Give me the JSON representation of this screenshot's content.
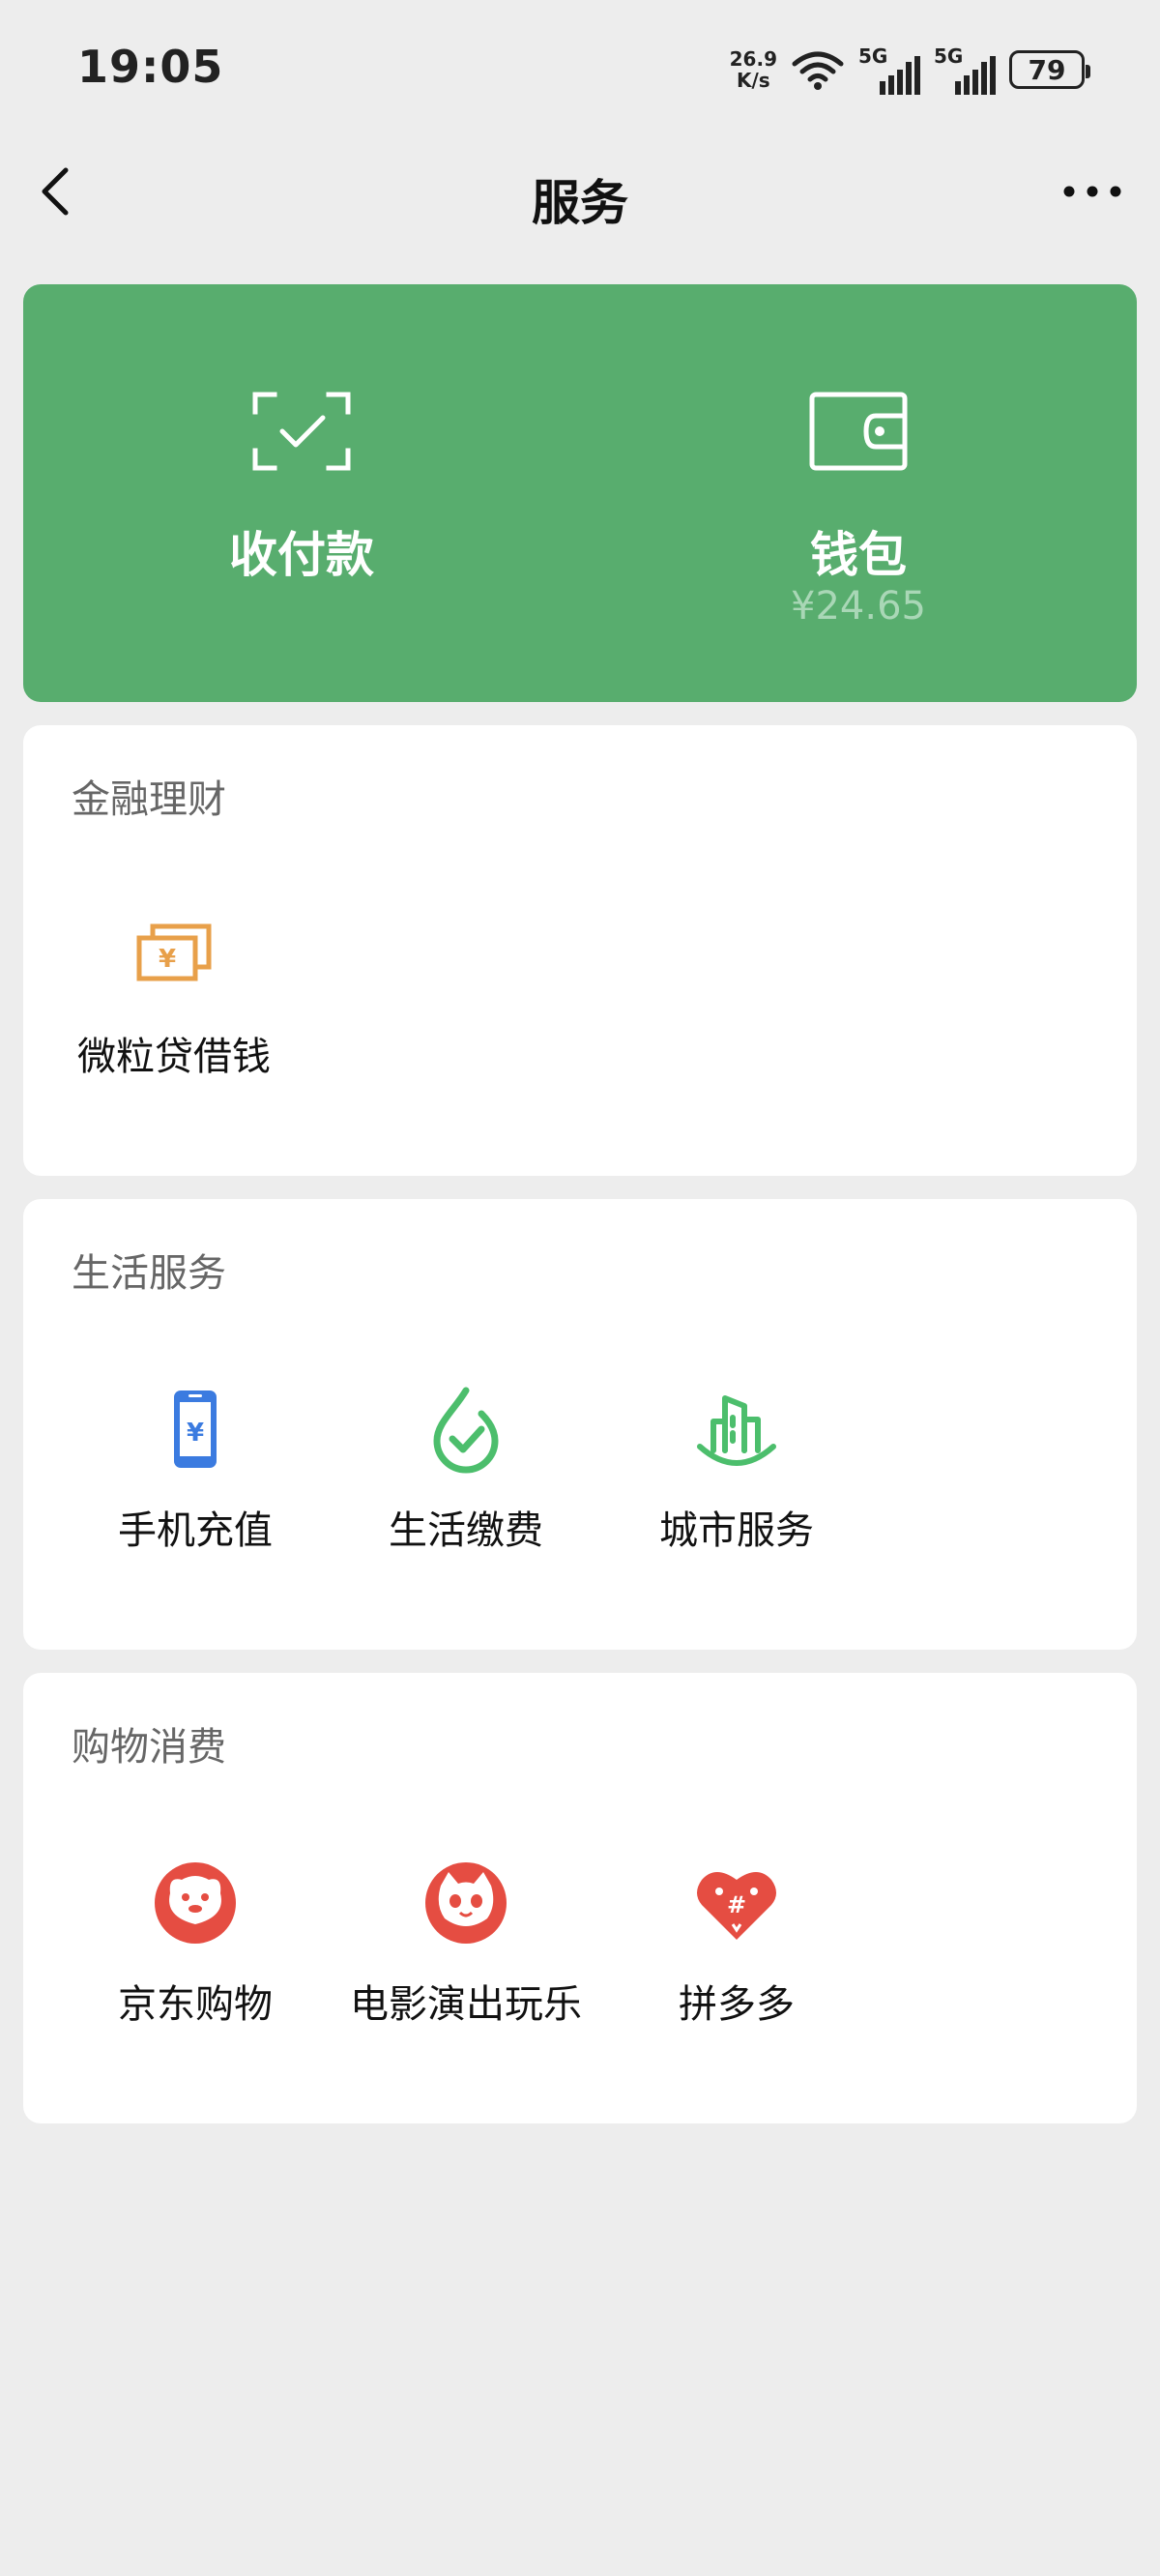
{
  "status_bar": {
    "time": "19:05",
    "net_speed_value": "26.9",
    "net_speed_unit": "K/s",
    "sim1": "5G",
    "sim2": "5G",
    "battery": "79"
  },
  "nav": {
    "title": "服务",
    "back_icon": "chevron-left-icon",
    "more_icon": "ellipsis-icon"
  },
  "hero": {
    "color": "#58ad6e",
    "pay": {
      "label": "收付款",
      "icon": "scan-check-icon"
    },
    "wallet": {
      "label": "钱包",
      "balance": "¥24.65",
      "icon": "wallet-icon"
    }
  },
  "sections": {
    "finance": {
      "title": "金融理财",
      "items": [
        {
          "label": "微粒贷借钱",
          "icon": "yuan-bills-icon",
          "color": "#e8a04a"
        }
      ]
    },
    "life": {
      "title": "生活服务",
      "items": [
        {
          "label": "手机充值",
          "icon": "phone-yuan-icon",
          "color": "#3b7be0"
        },
        {
          "label": "生活缴费",
          "icon": "water-drop-check-icon",
          "color": "#4cbe6c"
        },
        {
          "label": "城市服务",
          "icon": "city-buildings-icon",
          "color": "#4cbe6c"
        }
      ]
    },
    "shopping": {
      "title": "购物消费",
      "items": [
        {
          "label": "京东购物",
          "icon": "jd-dog-icon",
          "color": "#e54d42"
        },
        {
          "label": "电影演出玩乐",
          "icon": "cat-face-icon",
          "color": "#e54d42"
        },
        {
          "label": "拼多多",
          "icon": "pinduoduo-heart-icon",
          "color": "#e54d42"
        }
      ]
    }
  }
}
